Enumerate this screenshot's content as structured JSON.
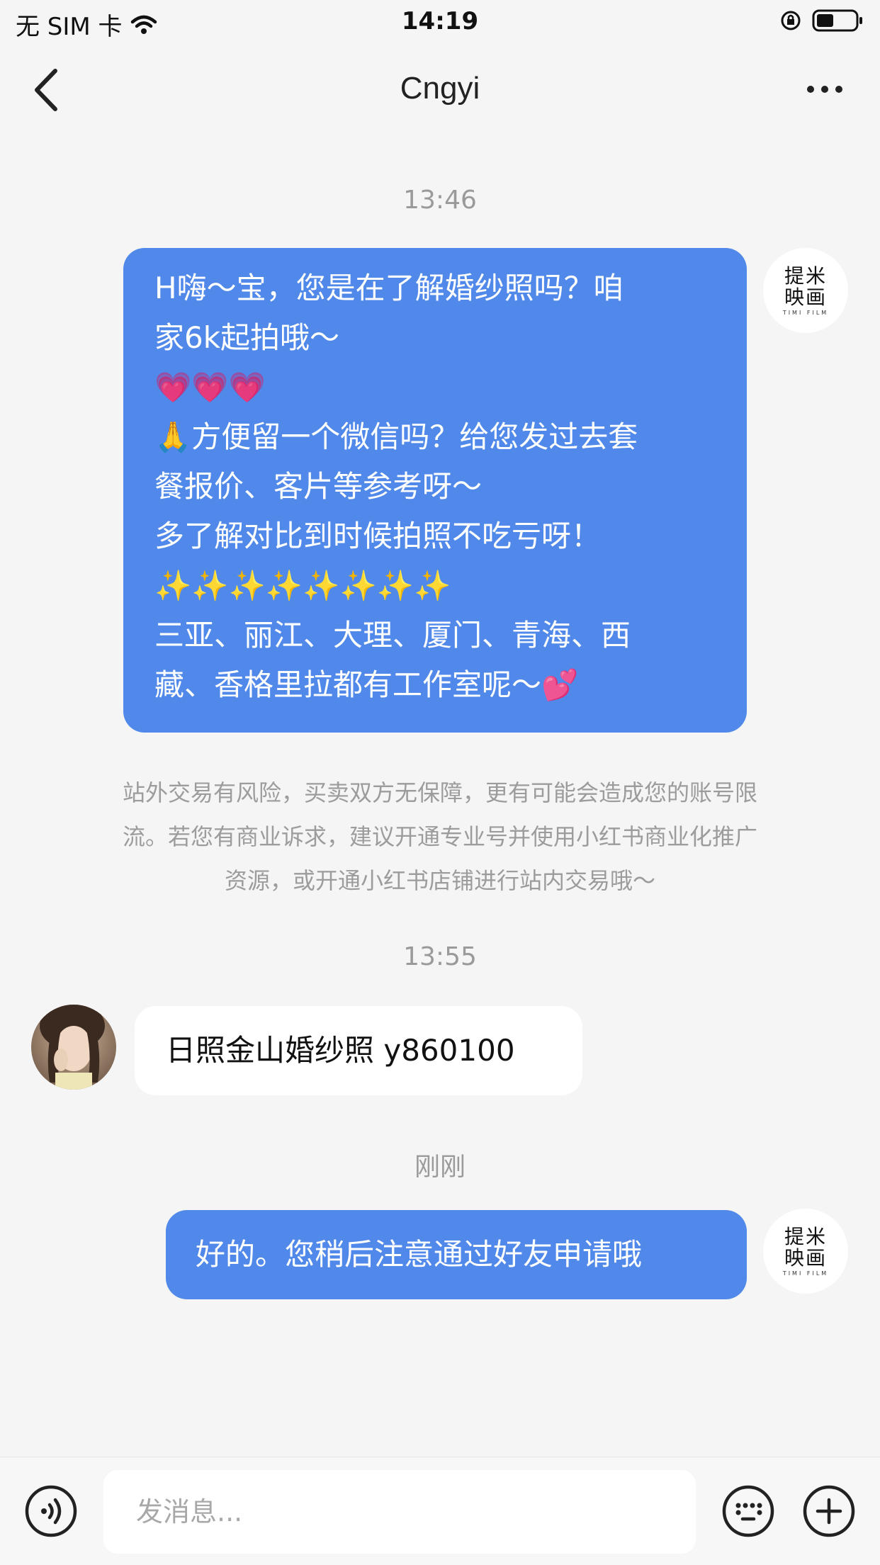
{
  "status_bar": {
    "carrier": "无 SIM 卡",
    "time": "14:19",
    "icons": [
      "wifi-icon",
      "rotation-lock-icon",
      "battery-icon"
    ],
    "battery_level": 0.45
  },
  "nav": {
    "title": "Cngyi",
    "back_icon": "chevron-left-icon",
    "more_icon": "more-dots-icon"
  },
  "studio_avatar": {
    "logo_line1": "提米",
    "logo_line2": "映画",
    "logo_sub": "TIMI FILM"
  },
  "messages": [
    {
      "timestamp": "13:46",
      "side": "right",
      "lines": [
        "H嗨～宝，您是在了解婚纱照吗？咱",
        "家6k起拍哦～",
        "💗💗💗",
        "🙏方便留一个微信吗？给您发过去套",
        "餐报价、客片等参考呀～",
        "多了解对比到时候拍照不吃亏呀！",
        "✨✨✨✨✨✨✨✨",
        "三亚、丽江、大理、厦门、青海、西",
        "藏、香格里拉都有工作室呢～💕"
      ]
    },
    {
      "timestamp": "13:55",
      "side": "left",
      "text": "日照金山婚纱照 y860100"
    },
    {
      "timestamp": "刚刚",
      "side": "right",
      "text": "好的。您稍后注意通过好友申请哦"
    }
  ],
  "warning": {
    "lines": [
      "站外交易有风险，买卖双方无保障，更有可能会造成您的账号限",
      "流。若您有商业诉求，建议开通专业号并使用小红书商业化推广",
      "资源，或开通小红书店铺进行站内交易哦～"
    ]
  },
  "input_bar": {
    "placeholder": "发消息...",
    "voice_icon": "voice-icon",
    "emoji_icon": "emoji-icon",
    "plus_icon": "plus-icon"
  }
}
